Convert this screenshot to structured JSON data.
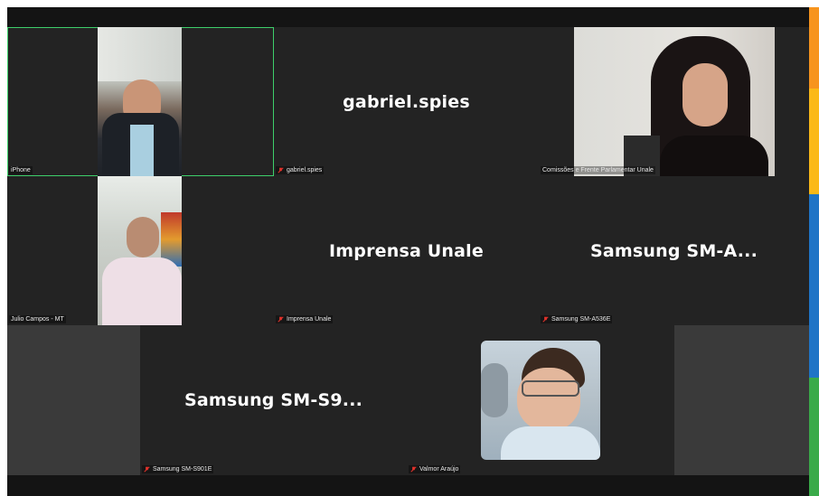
{
  "participants": [
    {
      "label": "iPhone",
      "display_name": "",
      "muted": false,
      "has_video": true
    },
    {
      "label": "gabriel.spies",
      "display_name": "gabriel.spies",
      "muted": true,
      "has_video": false
    },
    {
      "label": "Comissões e Frente Parlamentar Unale",
      "display_name": "",
      "muted": false,
      "has_video": true
    },
    {
      "label": "Julio Campos - MT",
      "display_name": "",
      "muted": false,
      "has_video": true
    },
    {
      "label": "Imprensa Unale",
      "display_name": "Imprensa Unale",
      "muted": true,
      "has_video": false
    },
    {
      "label": "Samsung SM-A536E",
      "display_name": "Samsung  SM-A...",
      "muted": true,
      "has_video": false
    },
    {
      "label": "Samsung SM-S901E",
      "display_name": "Samsung  SM-S9...",
      "muted": true,
      "has_video": false
    },
    {
      "label": "Valmor Araújo",
      "display_name": "",
      "muted": true,
      "has_video": true
    }
  ],
  "colors": {
    "active_speaker_border": "#3ecf6a",
    "mute_icon": "#e0322b",
    "tile_bg": "#232323",
    "side_strip": [
      "#f7941d",
      "#fbb917",
      "#1f74c6",
      "#3aaa49"
    ]
  }
}
